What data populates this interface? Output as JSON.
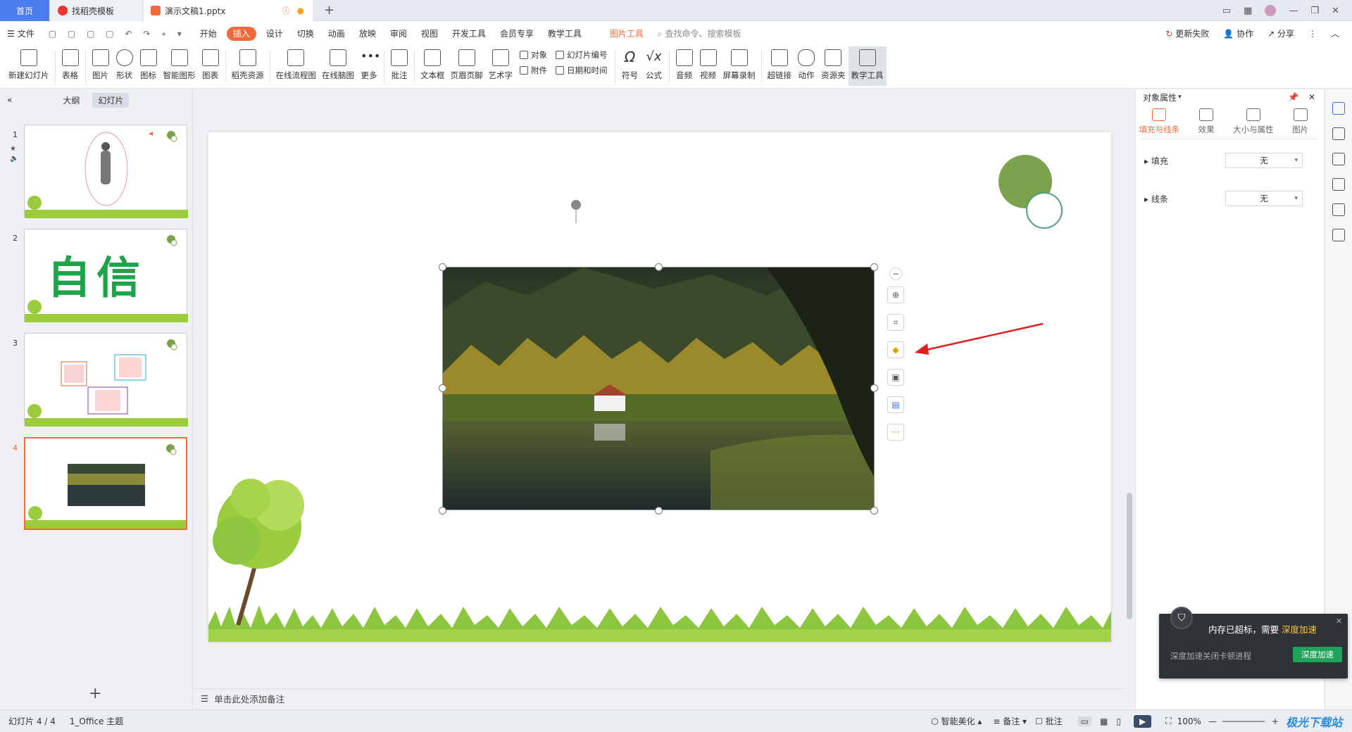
{
  "tabs": {
    "home": "首页",
    "template": "找稻壳模板",
    "doc": "演示文稿1.pptx"
  },
  "menu": {
    "file": "文件",
    "items": [
      "开始",
      "插入",
      "设计",
      "切换",
      "动画",
      "放映",
      "审阅",
      "视图",
      "开发工具",
      "会员专享",
      "教学工具"
    ],
    "active": "插入",
    "picture_tools": "图片工具",
    "search_placeholder": "查找命令、搜索模板",
    "update_failed": "更新失败",
    "collab": "协作",
    "share": "分享"
  },
  "ribbon": {
    "new_slide": "新建幻灯片",
    "table": "表格",
    "picture": "图片",
    "shape": "形状",
    "icon": "图标",
    "smart_shape": "智能图形",
    "chart": "图表",
    "docer_res": "稻壳资源",
    "online_flow": "在线流程图",
    "online_mind": "在线脑图",
    "more": "更多",
    "comment": "批注",
    "textbox": "文本框",
    "header_footer": "页眉页脚",
    "wordart": "艺术字",
    "object": "对象",
    "attach": "附件",
    "slide_num": "幻灯片编号",
    "datetime": "日期和时间",
    "symbol": "符号",
    "formula": "公式",
    "audio": "音频",
    "video": "视频",
    "screen_rec": "屏幕录制",
    "hyperlink": "超链接",
    "action": "动作",
    "resource": "资源夹",
    "teach_tools": "教学工具"
  },
  "left_pane": {
    "outline": "大纲",
    "slides": "幻灯片",
    "thumb_text_2": "自信",
    "slide_numbers": [
      "1",
      "2",
      "3",
      "4"
    ]
  },
  "right_pane": {
    "title": "对象属性",
    "tabs": [
      "填充与线条",
      "效果",
      "大小与属性",
      "图片"
    ],
    "fill_label": "填充",
    "fill_value": "无",
    "line_label": "线条",
    "line_value": "无"
  },
  "notes_placeholder": "单击此处添加备注",
  "status": {
    "slide_count": "幻灯片 4 / 4",
    "theme": "1_Office 主题",
    "smart_beautify": "智能美化",
    "notes": "备注",
    "comments": "批注",
    "zoom": "100%"
  },
  "toast": {
    "msg": "内存已超标，需要",
    "highlight": "深度加速",
    "sub": "深度加速关闭卡顿进程",
    "button": "深度加速"
  },
  "watermark": "极光下载站",
  "colors": {
    "accent": "#f16a3c",
    "green": "#7da24e",
    "home_tab": "#4b7cf0"
  }
}
